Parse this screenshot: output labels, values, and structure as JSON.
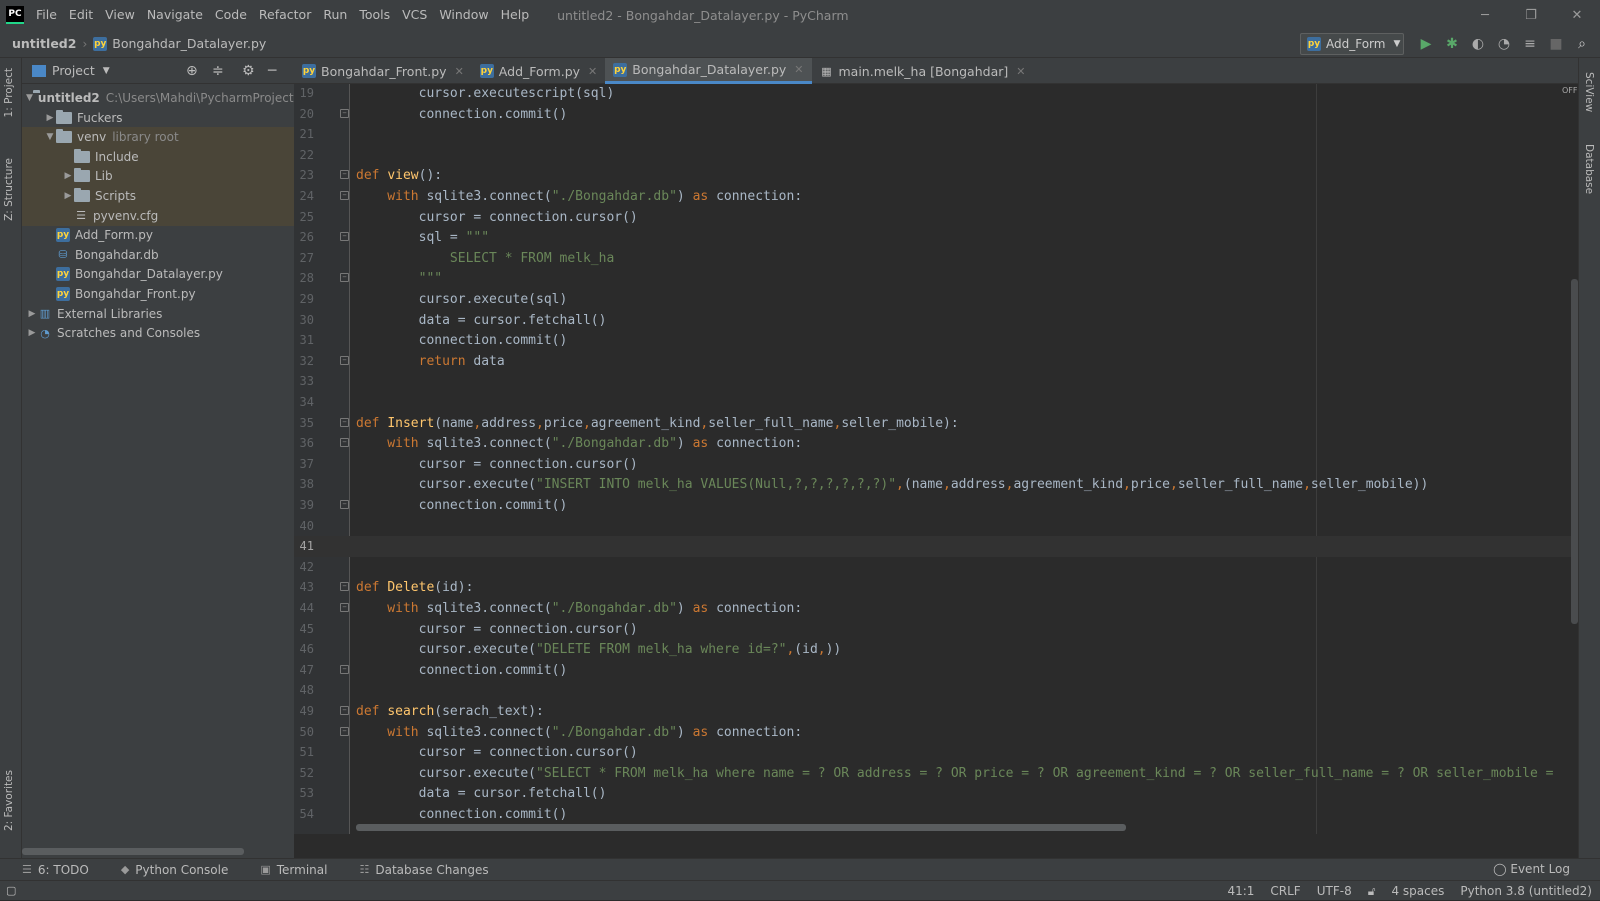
{
  "menubar": {
    "logo": "PC",
    "items": [
      "File",
      "Edit",
      "View",
      "Navigate",
      "Code",
      "Refactor",
      "Run",
      "Tools",
      "VCS",
      "Window",
      "Help"
    ],
    "window_title": "untitled2 - Bongahdar_Datalayer.py - PyCharm"
  },
  "navbar": {
    "root": "untitled2",
    "file": "Bongahdar_Datalayer.py",
    "run_config": "Add_Form"
  },
  "left_strip": {
    "project": "1: Project",
    "structure": "Z: Structure",
    "favorites": "2: Favorites"
  },
  "right_strip": {
    "sciview": "SciView",
    "database": "Database"
  },
  "project": {
    "title": "Project",
    "tree": [
      {
        "label": "untitled2",
        "hint": "C:\\Users\\Mahdi\\PycharmProjects",
        "indent": 0,
        "icon": "folder",
        "arrow": "▼",
        "bold": true,
        "hl": false
      },
      {
        "label": "Fuckers",
        "hint": "",
        "indent": 1,
        "icon": "folder",
        "arrow": "▶",
        "bold": false,
        "hl": false
      },
      {
        "label": "venv",
        "hint": "library root",
        "indent": 1,
        "icon": "folder",
        "arrow": "▼",
        "bold": false,
        "hl": true
      },
      {
        "label": "Include",
        "hint": "",
        "indent": 2,
        "icon": "folder",
        "arrow": "",
        "bold": false,
        "hl": true
      },
      {
        "label": "Lib",
        "hint": "",
        "indent": 2,
        "icon": "folder",
        "arrow": "▶",
        "bold": false,
        "hl": true
      },
      {
        "label": "Scripts",
        "hint": "",
        "indent": 2,
        "icon": "folder",
        "arrow": "▶",
        "bold": false,
        "hl": true
      },
      {
        "label": "pyvenv.cfg",
        "hint": "",
        "indent": 2,
        "icon": "cfg",
        "arrow": "",
        "bold": false,
        "hl": true
      },
      {
        "label": "Add_Form.py",
        "hint": "",
        "indent": 1,
        "icon": "py",
        "arrow": "",
        "bold": false,
        "hl": false
      },
      {
        "label": "Bongahdar.db",
        "hint": "",
        "indent": 1,
        "icon": "db",
        "arrow": "",
        "bold": false,
        "hl": false
      },
      {
        "label": "Bongahdar_Datalayer.py",
        "hint": "",
        "indent": 1,
        "icon": "py",
        "arrow": "",
        "bold": false,
        "hl": false
      },
      {
        "label": "Bongahdar_Front.py",
        "hint": "",
        "indent": 1,
        "icon": "py",
        "arrow": "",
        "bold": false,
        "hl": false
      },
      {
        "label": "External Libraries",
        "hint": "",
        "indent": 0,
        "icon": "lib",
        "arrow": "▶",
        "bold": false,
        "hl": false
      },
      {
        "label": "Scratches and Consoles",
        "hint": "",
        "indent": 0,
        "icon": "scratch",
        "arrow": "▶",
        "bold": false,
        "hl": false
      }
    ]
  },
  "tabs": [
    {
      "label": "Bongahdar_Front.py",
      "active": false,
      "icon": "py"
    },
    {
      "label": "Add_Form.py",
      "active": false,
      "icon": "py"
    },
    {
      "label": "Bongahdar_Datalayer.py",
      "active": true,
      "icon": "py"
    },
    {
      "label": "main.melk_ha [Bongahdar]",
      "active": false,
      "icon": "table"
    }
  ],
  "editor": {
    "current_line": "41",
    "off_badge": "OFF",
    "lines": [
      {
        "n": "19",
        "fold": false,
        "t": [
          [
            "",
            "        cursor.executescript(sql)"
          ]
        ]
      },
      {
        "n": "20",
        "fold": true,
        "t": [
          [
            "",
            "        connection.commit()"
          ]
        ]
      },
      {
        "n": "21",
        "fold": false,
        "t": []
      },
      {
        "n": "22",
        "fold": false,
        "t": []
      },
      {
        "n": "23",
        "fold": true,
        "t": [
          [
            "kw",
            "def "
          ],
          [
            "fn",
            "view"
          ],
          [
            "",
            "():"
          ]
        ]
      },
      {
        "n": "24",
        "fold": true,
        "t": [
          [
            "kw",
            "    with "
          ],
          [
            "",
            "sqlite3.connect("
          ],
          [
            "str",
            "\"./Bongahdar.db\""
          ],
          [
            "",
            ") "
          ],
          [
            "kw",
            "as "
          ],
          [
            "",
            "connection:"
          ]
        ]
      },
      {
        "n": "25",
        "fold": false,
        "t": [
          [
            "",
            "        cursor = connection.cursor()"
          ]
        ]
      },
      {
        "n": "26",
        "fold": true,
        "t": [
          [
            "",
            "        sql = "
          ],
          [
            "str",
            "\"\"\""
          ]
        ]
      },
      {
        "n": "27",
        "fold": false,
        "t": [
          [
            "str",
            "            SELECT * FROM melk_ha"
          ]
        ]
      },
      {
        "n": "28",
        "fold": true,
        "t": [
          [
            "str",
            "        \"\"\""
          ]
        ]
      },
      {
        "n": "29",
        "fold": false,
        "t": [
          [
            "",
            "        cursor.execute(sql)"
          ]
        ]
      },
      {
        "n": "30",
        "fold": false,
        "t": [
          [
            "",
            "        data = cursor.fetchall()"
          ]
        ]
      },
      {
        "n": "31",
        "fold": false,
        "t": [
          [
            "",
            "        connection.commit()"
          ]
        ]
      },
      {
        "n": "32",
        "fold": true,
        "t": [
          [
            "kw",
            "        return "
          ],
          [
            "",
            "data"
          ]
        ]
      },
      {
        "n": "33",
        "fold": false,
        "t": []
      },
      {
        "n": "34",
        "fold": false,
        "t": []
      },
      {
        "n": "35",
        "fold": true,
        "t": [
          [
            "kw",
            "def "
          ],
          [
            "fn",
            "Insert"
          ],
          [
            "",
            "(name"
          ],
          [
            "kw",
            ","
          ],
          [
            "",
            "address"
          ],
          [
            "kw",
            ","
          ],
          [
            "",
            "price"
          ],
          [
            "kw",
            ","
          ],
          [
            "",
            "agreement_kind"
          ],
          [
            "kw",
            ","
          ],
          [
            "",
            "seller_full_name"
          ],
          [
            "kw",
            ","
          ],
          [
            "",
            "seller_mobile):"
          ]
        ]
      },
      {
        "n": "36",
        "fold": true,
        "t": [
          [
            "kw",
            "    with "
          ],
          [
            "",
            "sqlite3.connect("
          ],
          [
            "str",
            "\"./Bongahdar.db\""
          ],
          [
            "",
            ") "
          ],
          [
            "kw",
            "as "
          ],
          [
            "",
            "connection:"
          ]
        ]
      },
      {
        "n": "37",
        "fold": false,
        "t": [
          [
            "",
            "        cursor = connection.cursor()"
          ]
        ]
      },
      {
        "n": "38",
        "fold": false,
        "t": [
          [
            "",
            "        cursor.execute("
          ],
          [
            "str",
            "\"INSERT INTO melk_ha VALUES(Null,?,?,?,?,?,?)\""
          ],
          [
            "kw",
            ","
          ],
          [
            "",
            "(name"
          ],
          [
            "kw",
            ","
          ],
          [
            "",
            "address"
          ],
          [
            "kw",
            ","
          ],
          [
            "",
            "agreement_kind"
          ],
          [
            "kw",
            ","
          ],
          [
            "",
            "price"
          ],
          [
            "kw",
            ","
          ],
          [
            "",
            "seller_full_name"
          ],
          [
            "kw",
            ","
          ],
          [
            "",
            "seller_mobile))"
          ]
        ]
      },
      {
        "n": "39",
        "fold": true,
        "t": [
          [
            "",
            "        connection.commit()"
          ]
        ]
      },
      {
        "n": "40",
        "fold": false,
        "t": []
      },
      {
        "n": "41",
        "fold": false,
        "t": []
      },
      {
        "n": "42",
        "fold": false,
        "t": []
      },
      {
        "n": "43",
        "fold": true,
        "t": [
          [
            "kw",
            "def "
          ],
          [
            "fn",
            "Delete"
          ],
          [
            "",
            "(id):"
          ]
        ]
      },
      {
        "n": "44",
        "fold": true,
        "t": [
          [
            "kw",
            "    with "
          ],
          [
            "",
            "sqlite3.connect("
          ],
          [
            "str",
            "\"./Bongahdar.db\""
          ],
          [
            "",
            ") "
          ],
          [
            "kw",
            "as "
          ],
          [
            "",
            "connection:"
          ]
        ]
      },
      {
        "n": "45",
        "fold": false,
        "t": [
          [
            "",
            "        cursor = connection.cursor()"
          ]
        ]
      },
      {
        "n": "46",
        "fold": false,
        "t": [
          [
            "",
            "        cursor.execute("
          ],
          [
            "str",
            "\"DELETE FROM melk_ha where id=?\""
          ],
          [
            "kw",
            ","
          ],
          [
            "",
            "(id"
          ],
          [
            "kw",
            ","
          ],
          [
            "",
            "))"
          ]
        ]
      },
      {
        "n": "47",
        "fold": true,
        "t": [
          [
            "",
            "        connection.commit()"
          ]
        ]
      },
      {
        "n": "48",
        "fold": false,
        "t": []
      },
      {
        "n": "49",
        "fold": true,
        "t": [
          [
            "kw",
            "def "
          ],
          [
            "fn",
            "search"
          ],
          [
            "",
            "(serach_text):"
          ]
        ]
      },
      {
        "n": "50",
        "fold": true,
        "t": [
          [
            "kw",
            "    with "
          ],
          [
            "",
            "sqlite3.connect("
          ],
          [
            "str",
            "\"./Bongahdar.db\""
          ],
          [
            "",
            ") "
          ],
          [
            "kw",
            "as "
          ],
          [
            "",
            "connection:"
          ]
        ]
      },
      {
        "n": "51",
        "fold": false,
        "t": [
          [
            "",
            "        cursor = connection.cursor()"
          ]
        ]
      },
      {
        "n": "52",
        "fold": false,
        "t": [
          [
            "",
            "        cursor.execute("
          ],
          [
            "str",
            "\"SELECT * FROM melk_ha where name = ? OR address = ? OR price = ? OR agreement_kind = ? OR seller_full_name = ? OR seller_mobile = "
          ]
        ]
      },
      {
        "n": "53",
        "fold": false,
        "t": [
          [
            "",
            "        data = cursor.fetchall()"
          ]
        ]
      },
      {
        "n": "54",
        "fold": false,
        "t": [
          [
            "",
            "        connection.commit()"
          ]
        ]
      }
    ]
  },
  "bottom_tools": [
    {
      "label": "6: TODO",
      "icon": "☰"
    },
    {
      "label": "Python Console",
      "icon": "◆"
    },
    {
      "label": "Terminal",
      "icon": "▣"
    },
    {
      "label": "Database Changes",
      "icon": "☷"
    }
  ],
  "event_log": "Event Log",
  "status": {
    "position": "41:1",
    "line_sep": "CRLF",
    "encoding": "UTF-8",
    "indent": "4 spaces",
    "interpreter": "Python 3.8 (untitled2)"
  }
}
